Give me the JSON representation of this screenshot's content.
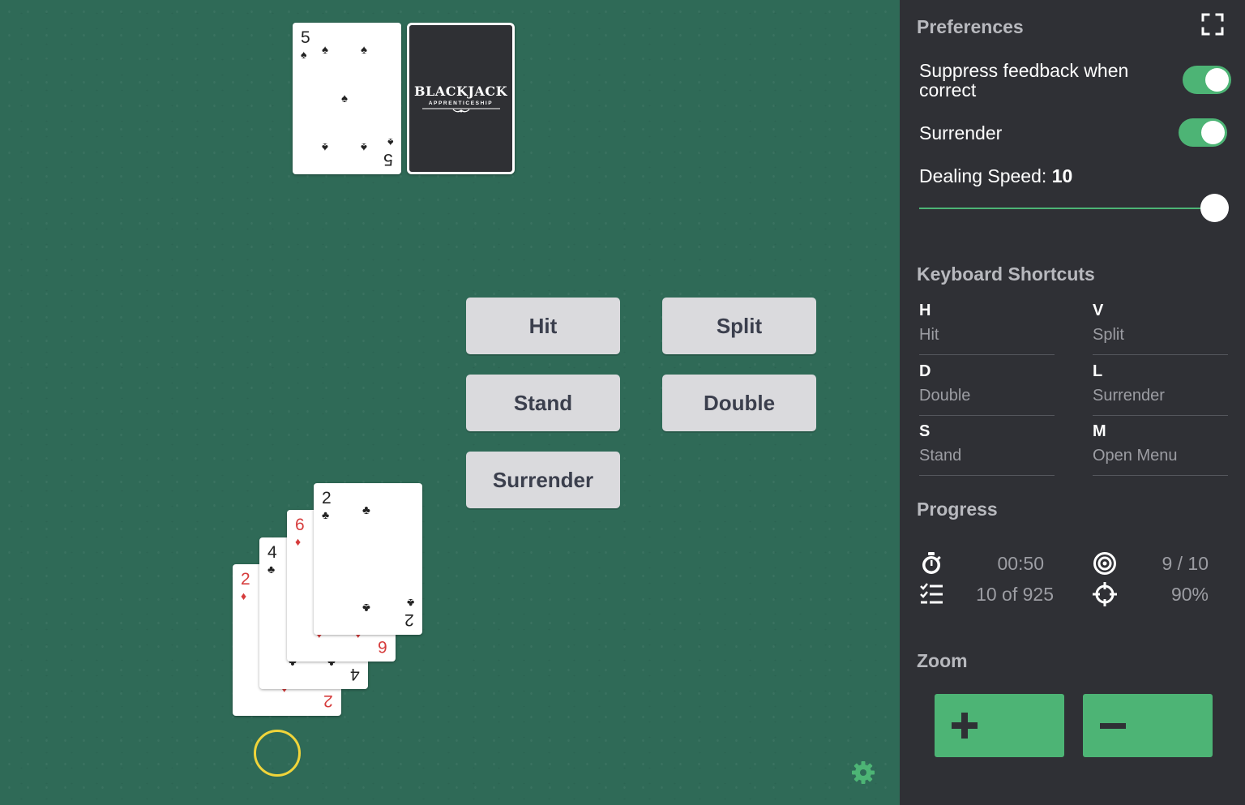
{
  "dealer": {
    "card_up": {
      "rank": "5",
      "suit": "♠",
      "color": "black"
    },
    "card_back": {
      "brand": "BLACKJACK",
      "subtitle": "APPRENTICESHIP"
    }
  },
  "player": {
    "cards": [
      {
        "rank": "2",
        "suit": "♦",
        "color": "red"
      },
      {
        "rank": "4",
        "suit": "♣",
        "color": "black"
      },
      {
        "rank": "6",
        "suit": "♦",
        "color": "red"
      },
      {
        "rank": "2",
        "suit": "♣",
        "color": "black"
      }
    ]
  },
  "actions": {
    "hit": "Hit",
    "split": "Split",
    "stand": "Stand",
    "double": "Double",
    "surrender": "Surrender"
  },
  "preferences": {
    "heading": "Preferences",
    "suppress_label": "Suppress feedback when correct",
    "suppress_on": true,
    "surrender_label": "Surrender",
    "surrender_on": true,
    "speed_label": "Dealing Speed:",
    "speed_value": "10",
    "speed_fraction": 1.0
  },
  "shortcuts": {
    "heading": "Keyboard Shortcuts",
    "items": [
      {
        "key": "H",
        "action": "Hit"
      },
      {
        "key": "V",
        "action": "Split"
      },
      {
        "key": "D",
        "action": "Double"
      },
      {
        "key": "L",
        "action": "Surrender"
      },
      {
        "key": "S",
        "action": "Stand"
      },
      {
        "key": "M",
        "action": "Open Menu"
      }
    ]
  },
  "progress": {
    "heading": "Progress",
    "time": "00:50",
    "hands": "10 of 925",
    "correct": "9 / 10",
    "accuracy": "90%"
  },
  "zoom": {
    "heading": "Zoom"
  },
  "colors": {
    "felt": "#2f6a57",
    "sidebar": "#2f3035",
    "accent": "#4db475",
    "ring": "#f0d43a"
  }
}
